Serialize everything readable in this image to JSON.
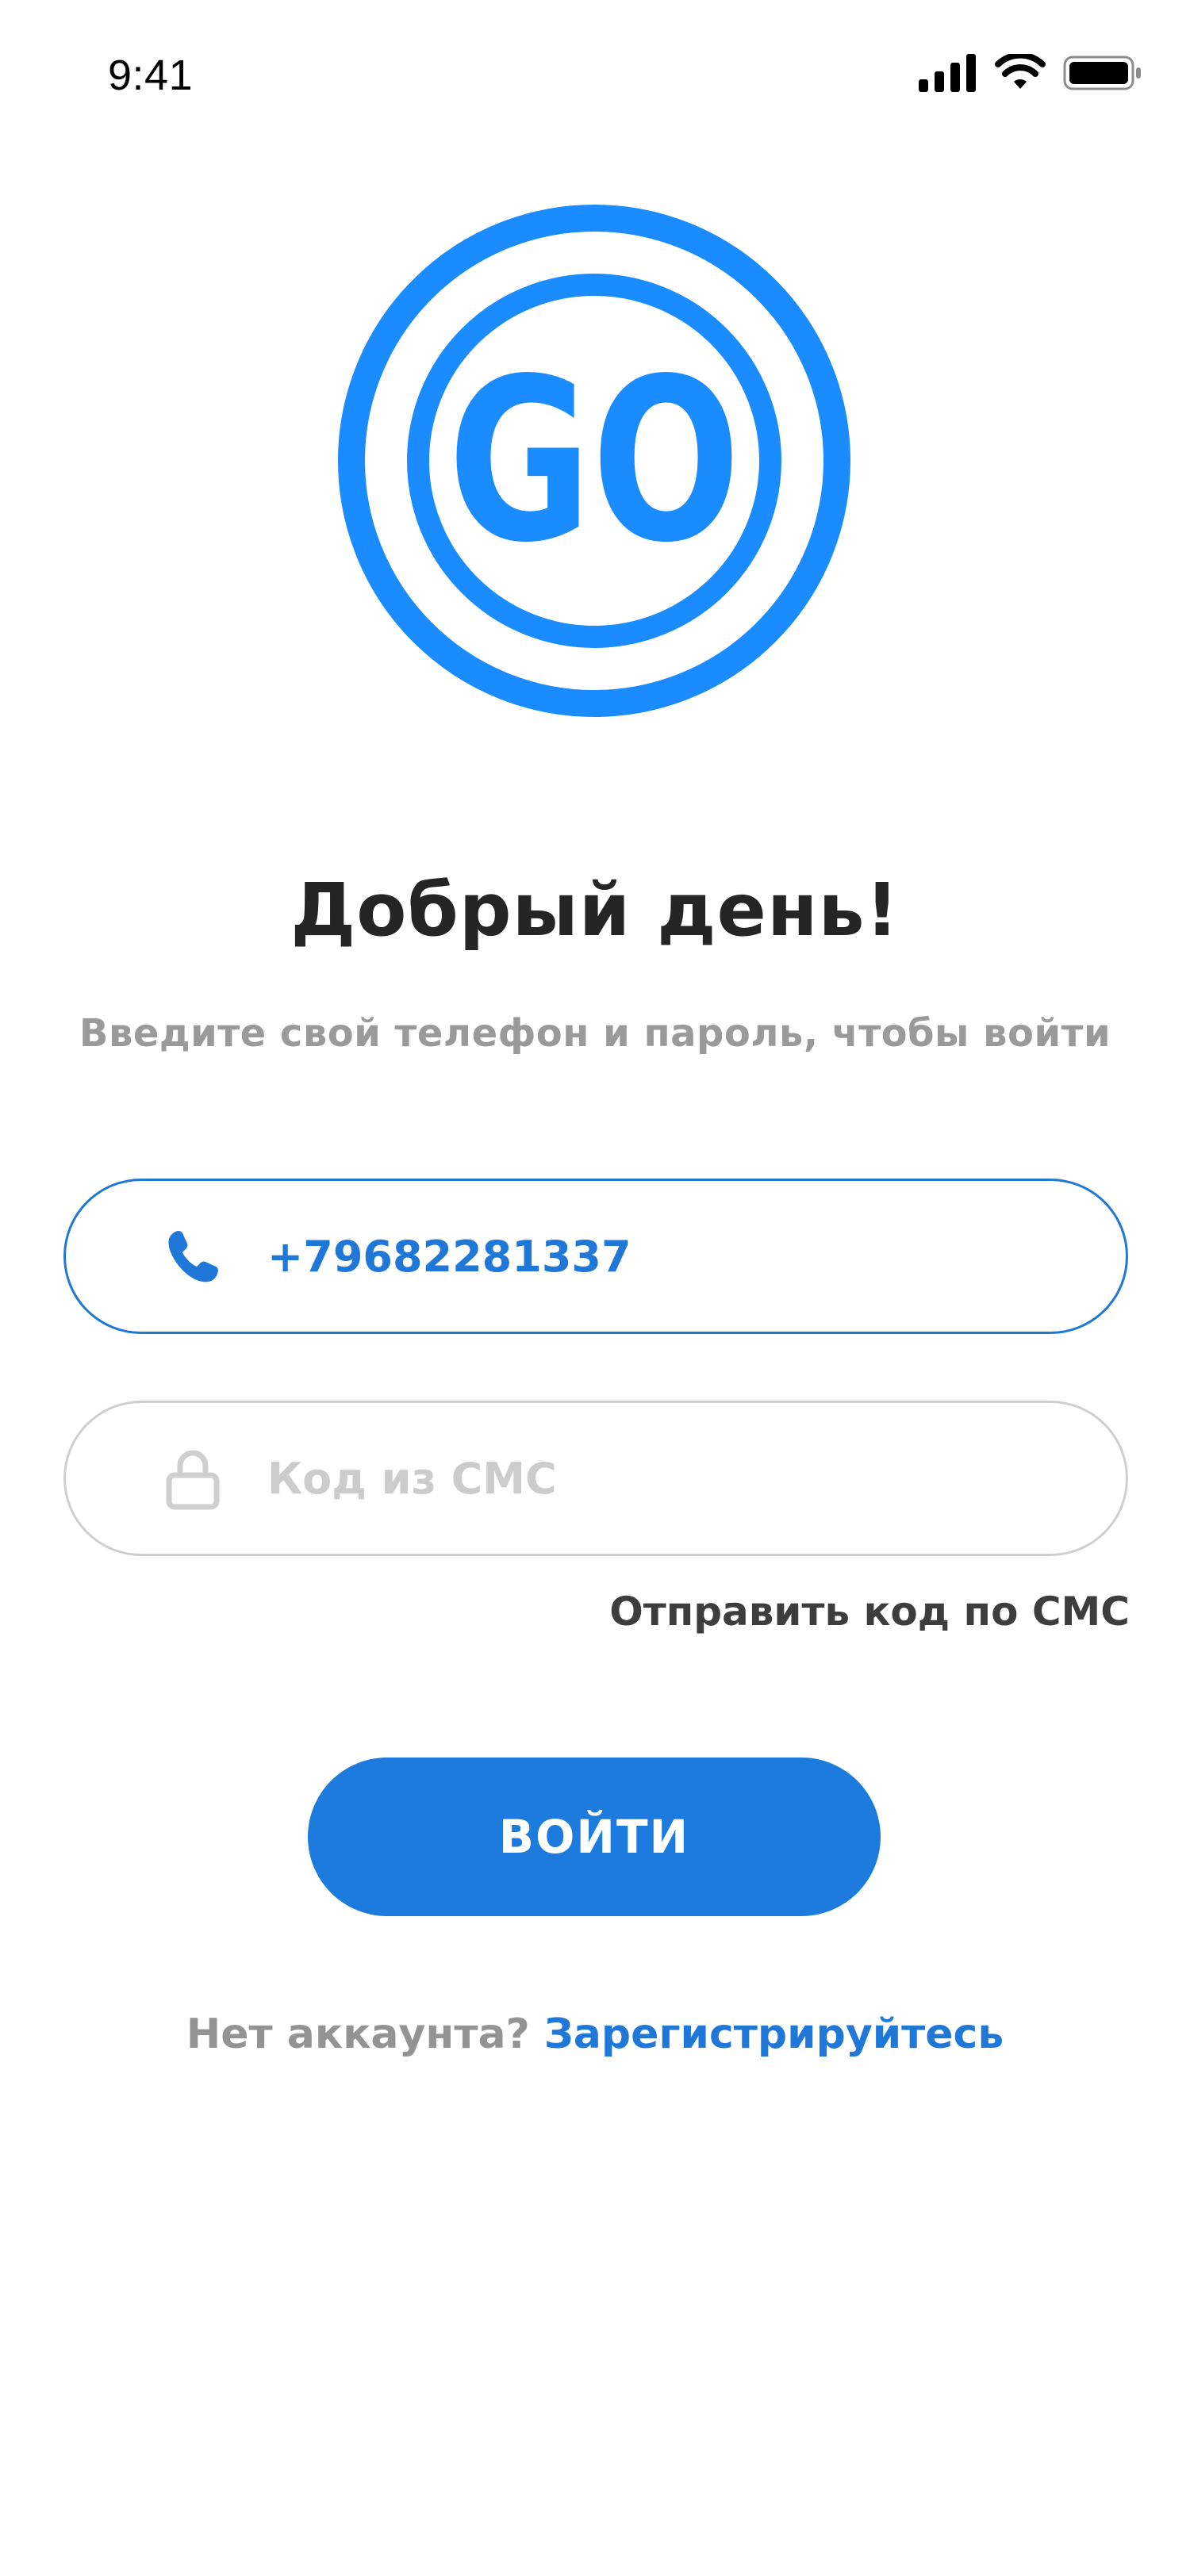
{
  "status_bar": {
    "time": "9:41",
    "icons": [
      "signal-icon",
      "wifi-icon",
      "battery-icon"
    ]
  },
  "logo": {
    "text": "GO",
    "color": "#1a8cff"
  },
  "greeting": "Добрый день!",
  "subtitle": "Введите свой телефон и пароль, чтобы войти",
  "phone_field": {
    "icon": "phone-icon",
    "value": "+79682281337"
  },
  "code_field": {
    "icon": "lock-icon",
    "placeholder": "Код из СМС",
    "value": ""
  },
  "send_code_label": "Отправить код по СМС",
  "login_button_label": "ВОЙТИ",
  "register": {
    "prompt": "Нет аккаунта?",
    "link_label": "Зарегистрируйтесь"
  },
  "colors": {
    "accent": "#1c7bdd",
    "logo": "#1a8cff",
    "heading": "#252525",
    "muted": "#9a9a9a",
    "inactive_border": "#cfcfcf"
  }
}
